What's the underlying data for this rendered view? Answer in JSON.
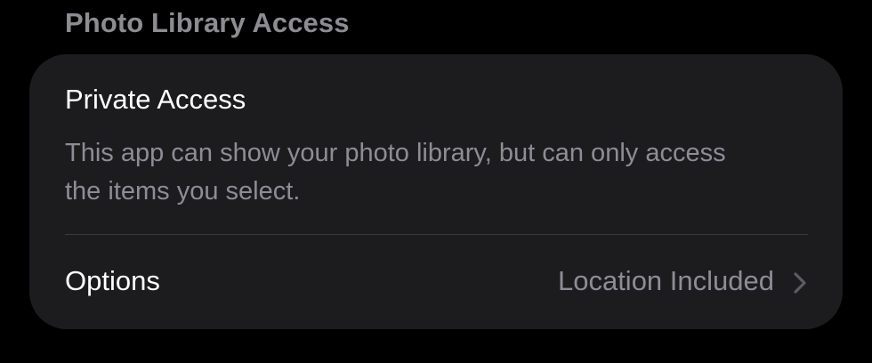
{
  "section": {
    "header": "Photo Library Access"
  },
  "private_access": {
    "title": "Private Access",
    "description": "This app can show your photo library, but can only access the items you select."
  },
  "options": {
    "label": "Options",
    "value": "Location Included",
    "chevron_icon": "chevron-right-icon"
  },
  "colors": {
    "background": "#000000",
    "card": "#1c1c1e",
    "primary_text": "#ffffff",
    "secondary_text": "#8d8d93",
    "separator": "#3a3a3c"
  }
}
